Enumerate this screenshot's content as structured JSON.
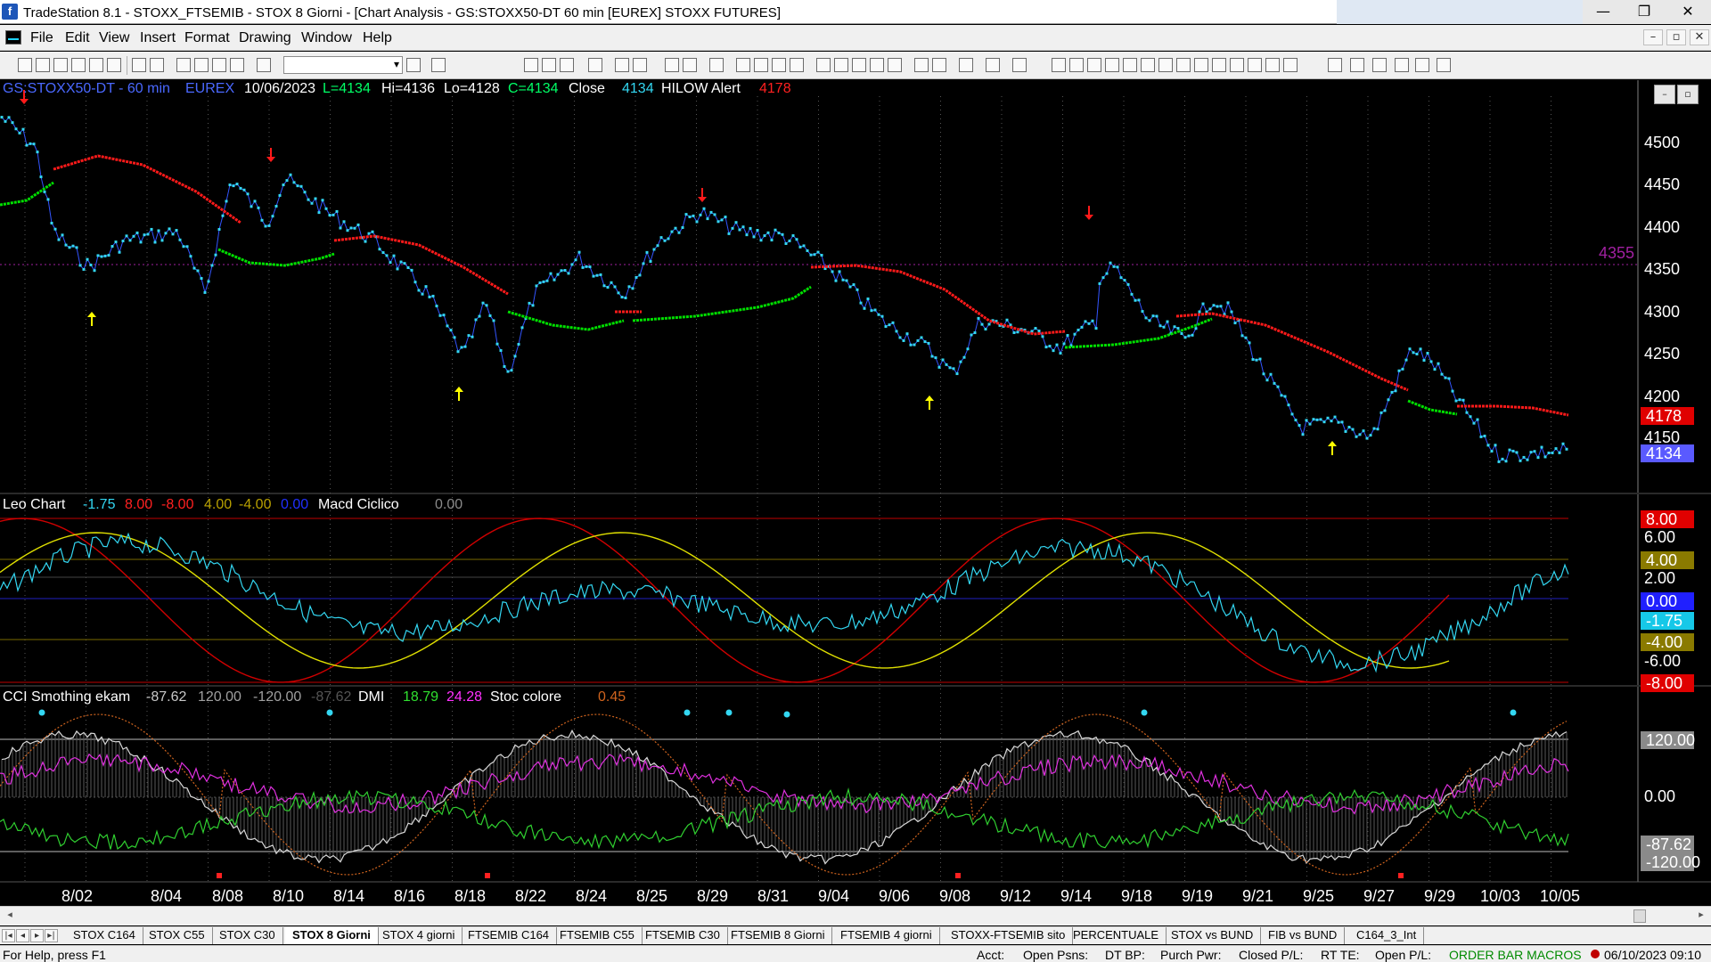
{
  "window": {
    "title": "TradeStation 8.1 - STOXX_FTSEMIB - STOX  8 Giorni - [Chart Analysis - GS:STOXX50-DT  60 min  [EUREX] STOXX FUTURES]",
    "minimize": "—",
    "maximize": "❐",
    "close": "✕"
  },
  "menu": {
    "items": [
      "File",
      "Edit",
      "View",
      "Insert",
      "Format",
      "Drawing",
      "Window",
      "Help"
    ],
    "mdi_min": "–",
    "mdi_restore": "▫",
    "mdi_close": "✕"
  },
  "chart": {
    "symbol_label": "GS:STOXX50-DT - 60 min",
    "exchange": "EUREX",
    "date": "10/06/2023",
    "last": "L=4134",
    "high": "Hi=4136",
    "low": "Lo=4128",
    "close_eq": "C=4134",
    "close_word": "Close",
    "close_value": "4134",
    "indicator_name": "HILOW Alert",
    "indicator_value": "4178",
    "level_line_label": "4355",
    "price_axis": [
      "4500",
      "4450",
      "4400",
      "4350",
      "4300",
      "4250",
      "4200",
      "4150"
    ],
    "price_tags": {
      "red": "4178",
      "blue": "4134"
    },
    "colors": {
      "price": "#33d7f2",
      "ma_up": "#00e000",
      "ma_down": "#ff1a1a",
      "arrow_down": "#ff1a1a",
      "arrow_up": "#ffff00",
      "level_line": "#a020a0"
    }
  },
  "panel2": {
    "name": "Leo Chart",
    "v1": "-1.75",
    "v2": "8.00",
    "v3": "-8.00",
    "v4": "4.00",
    "v5": "-4.00",
    "v6": "0.00",
    "name2": "Macd Ciclico",
    "v7": "0.00",
    "axis": {
      "a8": "8.00",
      "a6": "6.00",
      "a4": "4.00",
      "a2": "2.00",
      "a0": "0.00",
      "acur": "-1.75",
      "am4": "-4.00",
      "am6": "-6.00",
      "am8": "-8.00"
    }
  },
  "panel3": {
    "name": "CCI Smothing ekam",
    "v1": "-87.62",
    "v2": "120.00",
    "v3": "-120.00",
    "v4": "-87.62",
    "name2": "DMI",
    "v5": "18.79",
    "v6": "24.28",
    "name3": "Stoc colore",
    "v7": "0.45",
    "axis": {
      "a120": "120.00",
      "a0": "0.00",
      "acur": "-87.62",
      "am120": "-120.00"
    }
  },
  "dates": [
    "8/02",
    "8/04",
    "8/08",
    "8/10",
    "8/14",
    "8/16",
    "8/18",
    "8/22",
    "8/24",
    "8/25",
    "8/29",
    "8/31",
    "9/04",
    "9/06",
    "9/08",
    "9/12",
    "9/14",
    "9/18",
    "9/19",
    "9/21",
    "9/25",
    "9/27",
    "9/29",
    "10/03",
    "10/05"
  ],
  "tabs": [
    "STOX C164",
    "STOX C55",
    "STOX  C30",
    "STOX  8 Giorni",
    "STOX 4 giorni",
    "FTSEMIB C164",
    "FTSEMIB C55",
    "FTSEMIB C30",
    "FTSEMIB  8 Giorni",
    "FTSEMIB  4 giorni",
    "STOXX-FTSEMIB sito",
    "PERCENTUALE",
    "STOX vs BUND",
    "FIB vs BUND",
    "C164_3_Int"
  ],
  "status": {
    "help": "For Help, press F1",
    "acct": "Acct:",
    "open_psns": "Open Psns:",
    "dt_bp": "DT BP:",
    "purch_pwr": "Purch Pwr:",
    "closed_pl": "Closed P/L:",
    "rt_te": "RT TE:",
    "open_pl": "Open P/L:",
    "macros": "ORDER BAR  MACROS",
    "datetime": "06/10/2023 09:10"
  }
}
